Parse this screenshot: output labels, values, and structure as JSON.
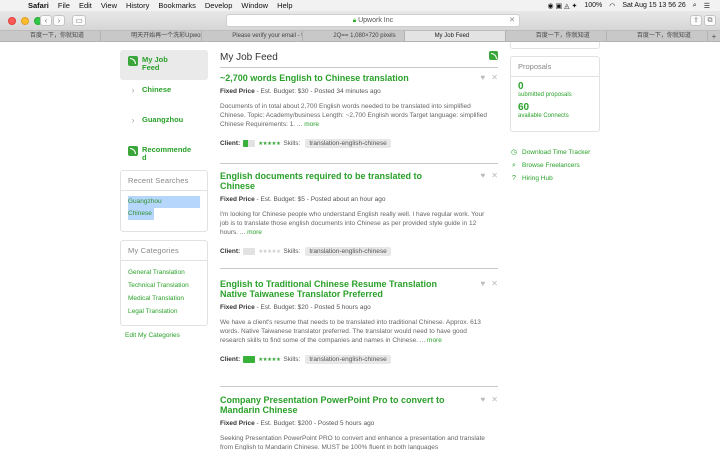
{
  "menubar": {
    "app": "Safari",
    "items": [
      "File",
      "Edit",
      "View",
      "History",
      "Bookmarks",
      "Develop",
      "Window",
      "Help"
    ],
    "battery": "100%",
    "clock": "Sat Aug 15  13 56 26"
  },
  "browser": {
    "url": "Upwork Inc",
    "tabs": [
      "百度一下，你就知道",
      "明天开始再一个洗彩Upwork全文特...",
      "Please verify your email - Upwork",
      "2Q==  1,080×720 pixels",
      "My Job Feed",
      "百度一下，你就知道",
      "百度一下，你就知道"
    ],
    "active_tab_index": 4
  },
  "sidebar": {
    "items": [
      {
        "label": "My Job Feed",
        "icon": "rss-icon"
      },
      {
        "label": "Chinese",
        "icon": "chevron-right-icon"
      },
      {
        "label": "Guangzhou",
        "icon": "chevron-right-icon"
      },
      {
        "label": "Recommended",
        "icon": "rss-icon"
      }
    ],
    "recent_searches": {
      "title": "Recent Searches",
      "items": [
        "Guangzhou",
        "Chinese"
      ]
    },
    "categories": {
      "title": "My Categories",
      "items": [
        "General Translation",
        "Technical Translation",
        "Medical Translation",
        "Legal Translation"
      ],
      "edit_label": "Edit My Categories"
    }
  },
  "feed": {
    "title": "My Job Feed",
    "jobs": [
      {
        "title": "~2,700 words English to Chinese translation",
        "type": "Fixed Price",
        "meta": "- Est. Budget: $30 - Posted 34 minutes ago",
        "desc": "Documents of in total about 2,700 English words needed to be translated into simplified Chinese. Topic: Academy/business Length: ~2,700 English words Target language: simplified Chinese Requirements: 1. ...",
        "more": "more",
        "client_label": "Client:",
        "client_verified": 0.4,
        "client_rating": 5,
        "skills_label": "Skills:",
        "skill": "translation-english-chinese"
      },
      {
        "title": "English documents required to be translated to Chinese",
        "type": "Fixed Price",
        "meta": "- Est. Budget: $5 - Posted about an hour ago",
        "desc": "I'm looking for Chinese people who understand English really well. I have regular work. Your job is to translate those english documents into Chinese as per provided style guide in 12 hours. ...",
        "more": "more",
        "client_label": "Client:",
        "client_verified": 0,
        "client_rating": 0,
        "skills_label": "Skills:",
        "skill": "translation-english-chinese"
      },
      {
        "title": "English to Traditional Chinese Resume Translation Native Taiwanese Translator Preferred",
        "type": "Fixed Price",
        "meta": "- Est. Budget: $20 - Posted 5 hours ago",
        "desc": "We have a client's resume that needs to be translated into traditional Chinese. Approx. 613 words. Native Taiwanese translator preferred. The translator would need to have good research skills to find some of the companies and names in Chinese. ...",
        "more": "more",
        "client_label": "Client:",
        "client_verified": 1,
        "client_rating": 5,
        "skills_label": "Skills:",
        "skill": "translation-english-chinese"
      },
      {
        "title": "Company Presentation PowerPoint Pro to convert to Mandarin Chinese",
        "type": "Fixed Price",
        "meta": "- Est. Budget: $200 - Posted 5 hours ago",
        "desc": "Seeking Presentation PowerPoint PRO to convert and enhance a presentation and translate from English to Mandarin Chinese. MUST be 100% fluent in both languages",
        "more": "",
        "client_label": "",
        "client_verified": 0,
        "client_rating": 0,
        "skills_label": "",
        "skill": ""
      }
    ]
  },
  "proposals": {
    "title": "Proposals",
    "submitted_count": "0",
    "submitted_label": "submitted proposals",
    "available_count": "60",
    "available_label": "available Connects"
  },
  "right_links": [
    {
      "label": "Download Time Tracker",
      "icon": "clock-icon"
    },
    {
      "label": "Browse Freelancers",
      "icon": "search-icon"
    },
    {
      "label": "Hiring Hub",
      "icon": "question-icon"
    }
  ],
  "colors": {
    "brand_green": "#2aa12a",
    "selection_blue": "#b6d7fb"
  }
}
